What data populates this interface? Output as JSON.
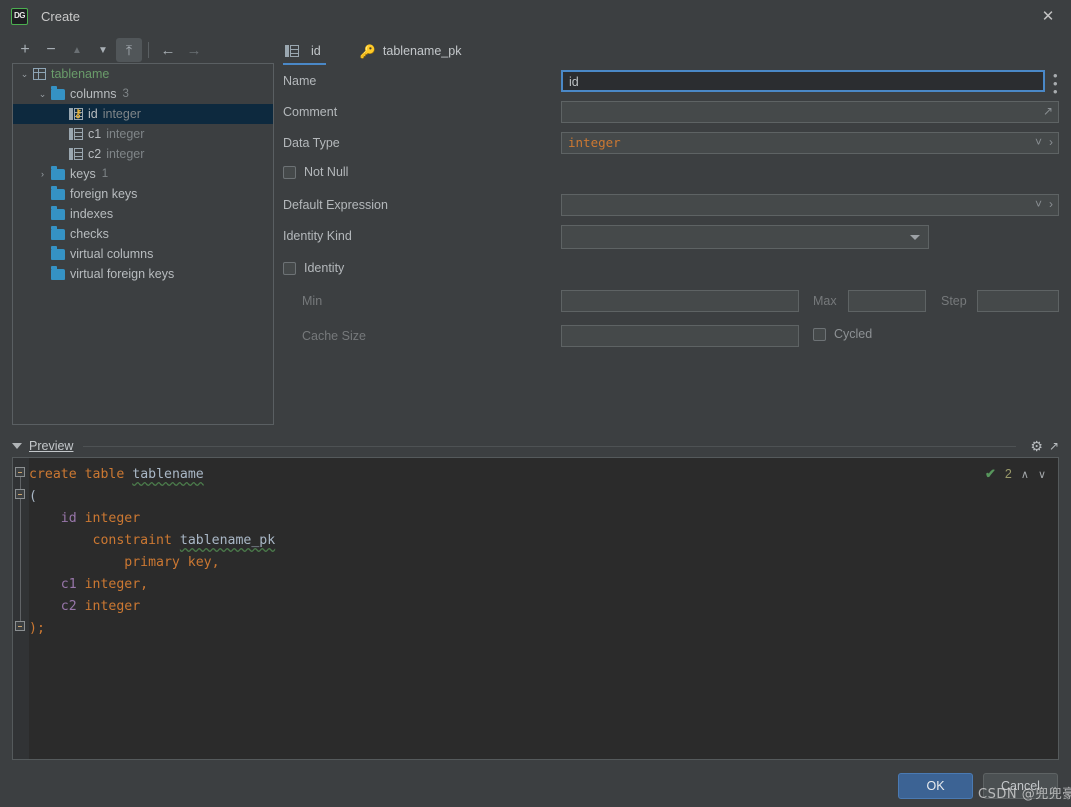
{
  "window": {
    "title": "Create",
    "logo_text": "DG",
    "close_icon": "✕"
  },
  "toolbar": {
    "add_label": "+",
    "remove_label": "−",
    "move_up_label": "▲",
    "move_down_label": "▼",
    "move_to_top_label": "⤒",
    "back_label": "←",
    "forward_label": "→"
  },
  "tree": {
    "rows": [
      {
        "arrow": "⌄",
        "icon": "table-icon",
        "indent": 0,
        "name": "tablename",
        "type": "",
        "count": "",
        "selected": false,
        "green": true
      },
      {
        "arrow": "⌄",
        "icon": "folder-icon",
        "indent": 1,
        "name": "columns",
        "type": "",
        "count": "3",
        "selected": false,
        "green": false
      },
      {
        "arrow": "",
        "icon": "column-key-icon",
        "indent": 2,
        "name": "id",
        "type": "integer",
        "count": "",
        "selected": true,
        "green": false
      },
      {
        "arrow": "",
        "icon": "column-icon",
        "indent": 2,
        "name": "c1",
        "type": "integer",
        "count": "",
        "selected": false,
        "green": false
      },
      {
        "arrow": "",
        "icon": "column-icon",
        "indent": 2,
        "name": "c2",
        "type": "integer",
        "count": "",
        "selected": false,
        "green": false
      },
      {
        "arrow": "›",
        "icon": "folder-icon",
        "indent": 1,
        "name": "keys",
        "type": "",
        "count": "1",
        "selected": false,
        "green": false
      },
      {
        "arrow": "",
        "icon": "folder-icon",
        "indent": 1,
        "name": "foreign keys",
        "type": "",
        "count": "",
        "selected": false,
        "green": false
      },
      {
        "arrow": "",
        "icon": "folder-icon",
        "indent": 1,
        "name": "indexes",
        "type": "",
        "count": "",
        "selected": false,
        "green": false
      },
      {
        "arrow": "",
        "icon": "folder-icon",
        "indent": 1,
        "name": "checks",
        "type": "",
        "count": "",
        "selected": false,
        "green": false
      },
      {
        "arrow": "",
        "icon": "folder-icon",
        "indent": 1,
        "name": "virtual columns",
        "type": "",
        "count": "",
        "selected": false,
        "green": false
      },
      {
        "arrow": "",
        "icon": "folder-icon",
        "indent": 1,
        "name": "virtual foreign keys",
        "type": "",
        "count": "",
        "selected": false,
        "green": false
      }
    ]
  },
  "tabs": [
    {
      "label": "id",
      "icon": "column-icon",
      "active": true
    },
    {
      "label": "tablename_pk",
      "icon": "key-icon",
      "active": false
    }
  ],
  "form": {
    "name_label": "Name",
    "name_value": "id",
    "name_menu_icon": "more-vertical-icon",
    "comment_label": "Comment",
    "comment_value": "",
    "comment_expand_icon": "expand-icon",
    "data_type_label": "Data Type",
    "data_type_value": "integer",
    "not_null_label": "Not Null",
    "not_null_checked": false,
    "default_expression_label": "Default Expression",
    "default_expression_value": "",
    "identity_kind_label": "Identity Kind",
    "identity_kind_value": "",
    "identity_label": "Identity",
    "identity_checked": false,
    "min_label": "Min",
    "min_value": "",
    "max_label": "Max",
    "max_value": "",
    "step_label": "Step",
    "step_value": "",
    "cache_size_label": "Cache Size",
    "cache_size_value": "",
    "cycled_label": "Cycled",
    "cycled_checked": false
  },
  "preview": {
    "title": "Preview",
    "settings_icon": "gear-icon",
    "popout_icon": "open-external-icon",
    "inspection_check_icon": "✔",
    "inspection_count": "2",
    "inspection_prev_icon": "∧",
    "inspection_next_icon": "∨",
    "sql": {
      "line1_kw1": "create",
      "line1_kw2": "table",
      "line1_ident": "tablename",
      "line2": "(",
      "line3_col": "id",
      "line3_type": "integer",
      "line4_kw": "constraint",
      "line4_ident": "tablename_pk",
      "line5": "primary key,",
      "line6_col": "c1",
      "line6_type": "integer,",
      "line7_col": "c2",
      "line7_type": "integer",
      "line8": ");"
    }
  },
  "buttons": {
    "ok_label": "OK",
    "cancel_label": "Cancel"
  },
  "watermark": {
    "text": "CSDN @兜兜豪"
  },
  "colors": {
    "accent": "#4a88c7",
    "ok_button": "#3c6394",
    "selection": "#0d293e",
    "folder": "#3592c4",
    "key": "#e8b33a",
    "keyword": "#cc7832",
    "identifier": "#9876aa",
    "editor_bg": "#2b2b2b",
    "dialog_bg": "#3c3f41"
  }
}
